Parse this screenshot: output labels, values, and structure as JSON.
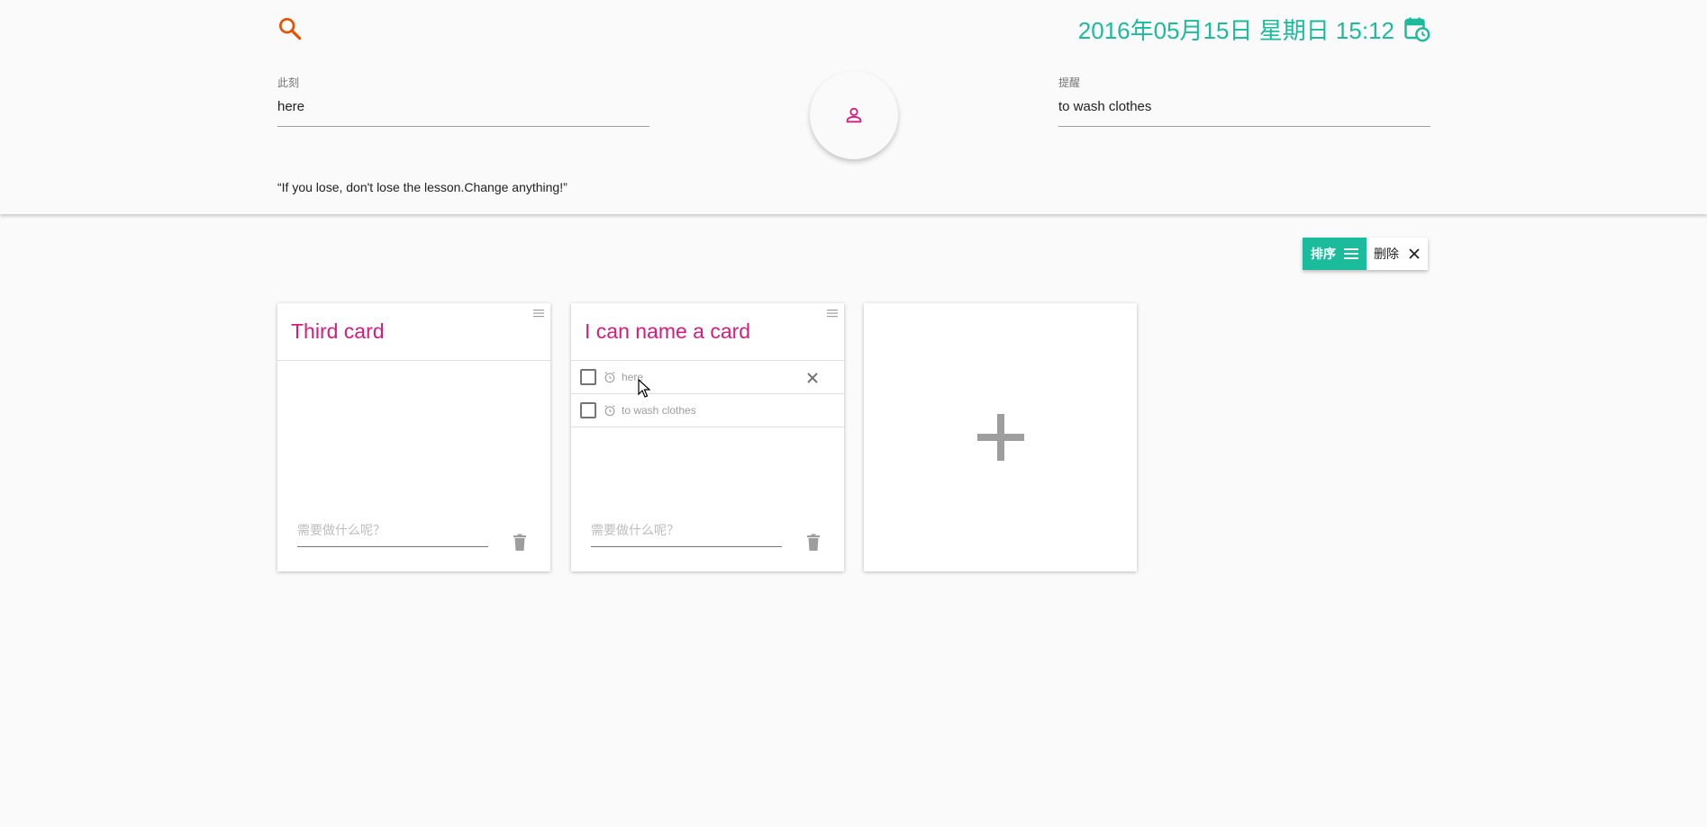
{
  "header": {
    "datetime": "2016年05月15日 星期日 15:12",
    "now_field": {
      "label": "此刻",
      "value": "here"
    },
    "reminder_field": {
      "label": "提醒",
      "value": "to wash clothes"
    },
    "quote": "“If you lose, don't lose the lesson.Change anything!”"
  },
  "toolbar": {
    "sort_label": "排序",
    "delete_label": "删除"
  },
  "cards": [
    {
      "title": "Third card",
      "todos": [],
      "new_todo_placeholder": "需要做什么呢？"
    },
    {
      "title": "I can name a card",
      "todos": [
        {
          "text": "here"
        },
        {
          "text": "to wash clothes"
        }
      ],
      "new_todo_placeholder": "需要做什么呢？"
    }
  ],
  "colors": {
    "accent": "#1abc9c",
    "title_pink": "#d81b7f",
    "search_orange": "#e65100"
  },
  "icons": [
    "search-icon",
    "calendar-clock-icon",
    "person-icon",
    "sort-icon",
    "close-icon",
    "drag-handle-icon",
    "alarm-icon",
    "trash-icon",
    "plus-icon"
  ]
}
